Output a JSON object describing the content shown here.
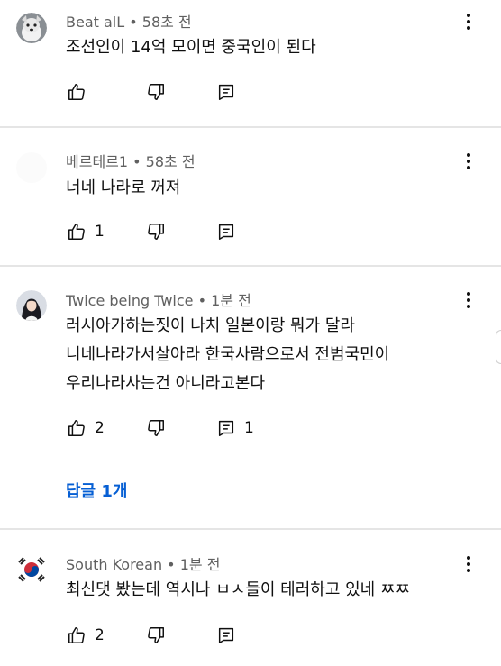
{
  "comments": [
    {
      "author": "Beat alL",
      "time": "58초 전",
      "lines": [
        "조선인이 14억 모이면 중국인이 된다"
      ],
      "like_count": "",
      "reply_count": ""
    },
    {
      "author": "베르테르1",
      "time": "58초 전",
      "lines": [
        "너네 나라로 꺼져"
      ],
      "like_count": "1",
      "reply_count": ""
    },
    {
      "author": "Twice being Twice",
      "time": "1분 전",
      "lines": [
        "러시아가하는짓이 나치 일본이랑 뭐가 달라",
        "니네나라가서살아라 한국사람으로서 전범국민이",
        "우리나라사는건 아니라고본다"
      ],
      "like_count": "2",
      "reply_count": "1",
      "replies_link": "답글 1개"
    },
    {
      "author": "South Korean",
      "time": "1분 전",
      "lines": [
        "최신댓 봤는데 역시나 ㅂㅅ들이 테러하고 있네 ㅉㅉ"
      ],
      "like_count": "2",
      "reply_count": ""
    }
  ],
  "separator": " • ",
  "icons": {
    "like": "thumb-up-icon",
    "dislike": "thumb-down-icon",
    "reply": "comment-reply-icon",
    "menu": "more-vert-icon"
  },
  "colors": {
    "meta": "#606060",
    "text": "#0f0f0f",
    "link": "#065fd4",
    "divider": "#e5e5e5"
  }
}
